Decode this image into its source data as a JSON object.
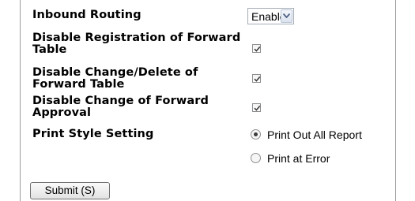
{
  "form": {
    "rows": [
      {
        "label": "Inbound Routing"
      },
      {
        "label": "Disable Registration of Forward Table",
        "checked": true
      },
      {
        "label": "Disable Change/Delete of Forward Table",
        "checked": true
      },
      {
        "label": "Disable Change of Forward Approval",
        "checked": true
      },
      {
        "label": "Print Style Setting"
      }
    ],
    "inbound_routing": {
      "selected": "Enable"
    },
    "print_style": {
      "options": [
        {
          "label": "Print Out All Report",
          "selected": true
        },
        {
          "label": "Print at Error",
          "selected": false
        }
      ]
    },
    "submit_label": "Submit (S)"
  },
  "colors": {
    "border": "#9a9a9a",
    "checkmark": "#3a3a3a"
  }
}
